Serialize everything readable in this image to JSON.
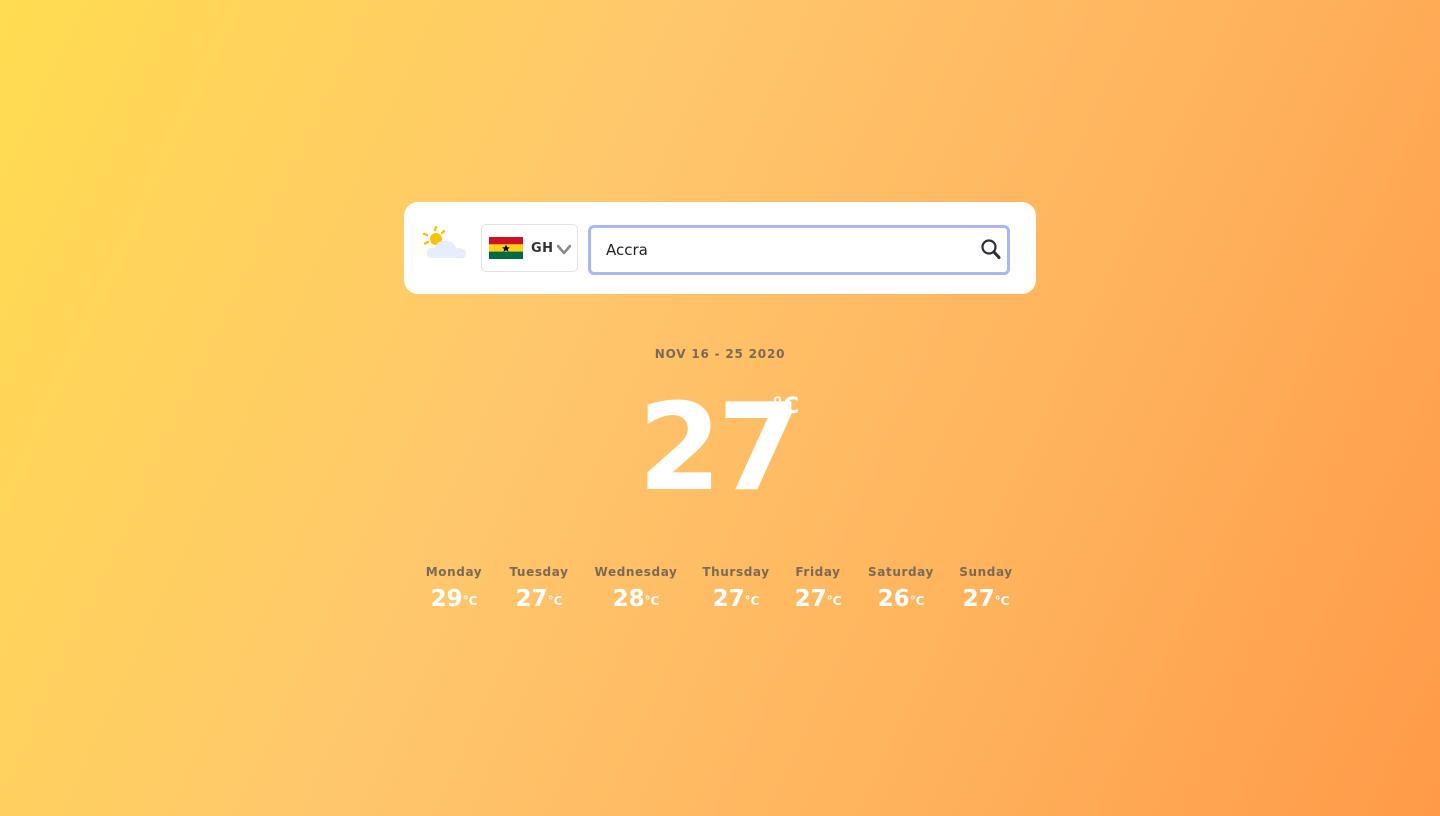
{
  "app": {
    "logo_icon": "sun-behind-cloud-icon"
  },
  "search_card": {
    "country": {
      "code": "GH",
      "flag_icon": "ghana-flag-icon",
      "flag_colors": [
        "#ce1126",
        "#fcd116",
        "#006b3f",
        "#000000"
      ]
    },
    "search": {
      "value": "Accra",
      "icon": "search-icon",
      "focus_color": "#a9b7f7"
    }
  },
  "current": {
    "date_range": "NOV 16 - 25 2020",
    "temperature": "27",
    "unit": "°C"
  },
  "forecast": [
    {
      "day": "Monday",
      "temp": "29",
      "unit": "°C"
    },
    {
      "day": "Tuesday",
      "temp": "27",
      "unit": "°C"
    },
    {
      "day": "Wednesday",
      "temp": "28",
      "unit": "°C"
    },
    {
      "day": "Thursday",
      "temp": "27",
      "unit": "°C"
    },
    {
      "day": "Friday",
      "temp": "27",
      "unit": "°C"
    },
    {
      "day": "Saturday",
      "temp": "26",
      "unit": "°C"
    },
    {
      "day": "Sunday",
      "temp": "27",
      "unit": "°C"
    }
  ],
  "colors": {
    "background_start": "#ffdc50",
    "background_end": "#ff9a48",
    "label_text": "#7a6a55",
    "temperature_text": "#ffffff"
  }
}
